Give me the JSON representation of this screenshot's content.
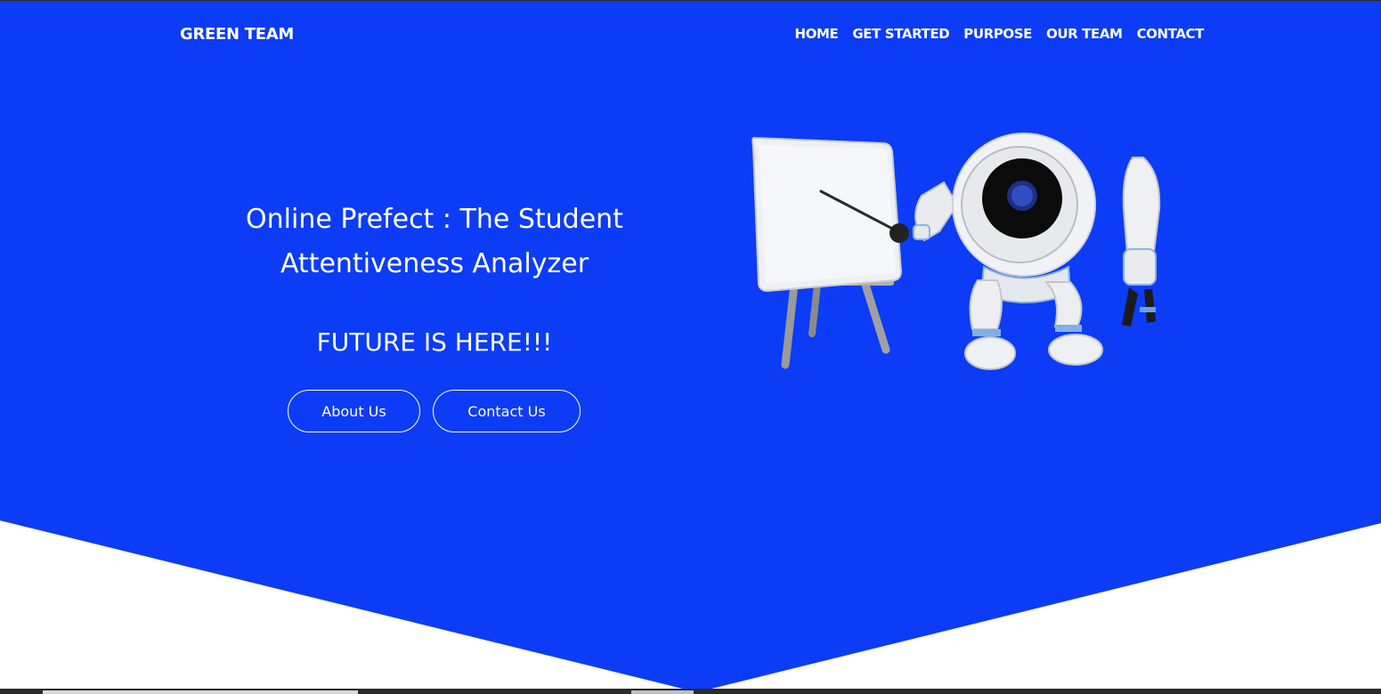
{
  "brand": "GREEN TEAM",
  "nav": {
    "items": [
      "HOME",
      "GET STARTED",
      "PURPOSE",
      "OUR TEAM",
      "CONTACT"
    ]
  },
  "hero": {
    "title_line1": "Online Prefect : The Student",
    "title_line2": "Attentiveness Analyzer",
    "subtitle": "FUTURE IS HERE!!!",
    "about_label": "About Us",
    "contact_label": "Contact Us",
    "illustration": "robot-presenting-at-whiteboard"
  },
  "colors": {
    "hero_blue": "#0c3cf5",
    "text": "#ffffff",
    "background": "#ffffff"
  }
}
